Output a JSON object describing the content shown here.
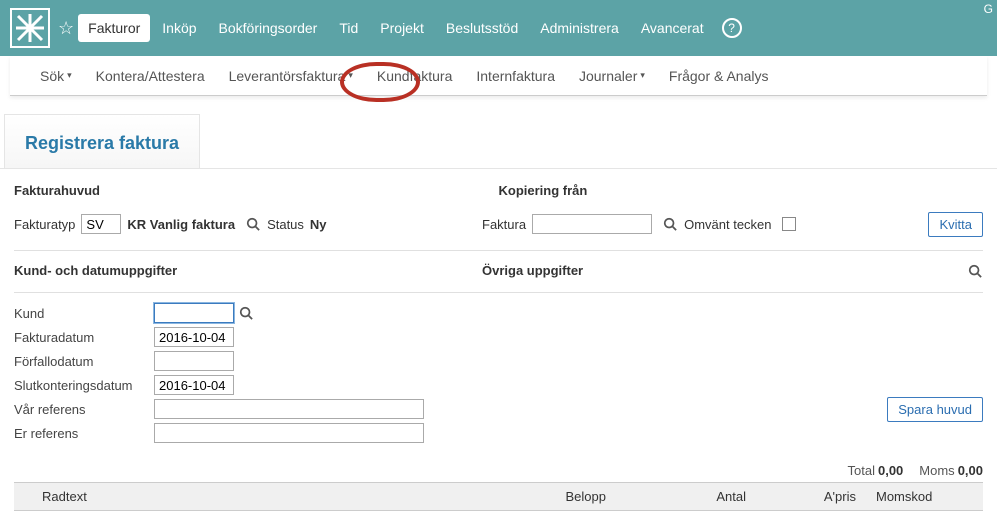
{
  "topbar": {
    "menu": [
      "Fakturor",
      "Inköp",
      "Bokföringsorder",
      "Tid",
      "Projekt",
      "Beslutsstöd",
      "Administrera",
      "Avancerat"
    ],
    "activeIndex": 0,
    "cornerLetter": "G"
  },
  "submenu": {
    "items": [
      {
        "label": "Sök",
        "caret": true
      },
      {
        "label": "Kontera/Attestera",
        "caret": false
      },
      {
        "label": "Leverantörsfaktura",
        "caret": true
      },
      {
        "label": "Kundfaktura",
        "caret": false
      },
      {
        "label": "Internfaktura",
        "caret": false
      },
      {
        "label": "Journaler",
        "caret": true
      },
      {
        "label": "Frågor & Analys",
        "caret": false
      }
    ]
  },
  "page": {
    "title": "Registrera faktura"
  },
  "head": {
    "fakturahuvud_label": "Fakturahuvud",
    "kopiering_label": "Kopiering från",
    "fakturatyp_label": "Fakturatyp",
    "fakturatyp_value": "SV",
    "fakturatyp_desc": "KR Vanlig faktura",
    "status_label": "Status",
    "status_value": "Ny",
    "faktura_label": "Faktura",
    "faktura_value": "",
    "omvant_label": "Omvänt tecken",
    "kvitta_btn": "Kvitta"
  },
  "left": {
    "section_label": "Kund- och datumuppgifter",
    "kund_label": "Kund",
    "kund_value": "",
    "fakturadatum_label": "Fakturadatum",
    "fakturadatum_value": "2016-10-04",
    "forfallodatum_label": "Förfallodatum",
    "forfallodatum_value": "",
    "slutkont_label": "Slutkonteringsdatum",
    "slutkont_value": "2016-10-04",
    "varref_label": "Vår referens",
    "varref_value": "",
    "erref_label": "Er referens",
    "erref_value": ""
  },
  "right": {
    "section_label": "Övriga uppgifter",
    "spara_btn": "Spara huvud"
  },
  "totals": {
    "total_label": "Total",
    "total_value": "0,00",
    "moms_label": "Moms",
    "moms_value": "0,00"
  },
  "table": {
    "cols": {
      "radtext": "Radtext",
      "belopp": "Belopp",
      "antal": "Antal",
      "apris": "A'pris",
      "momskod": "Momskod"
    }
  }
}
